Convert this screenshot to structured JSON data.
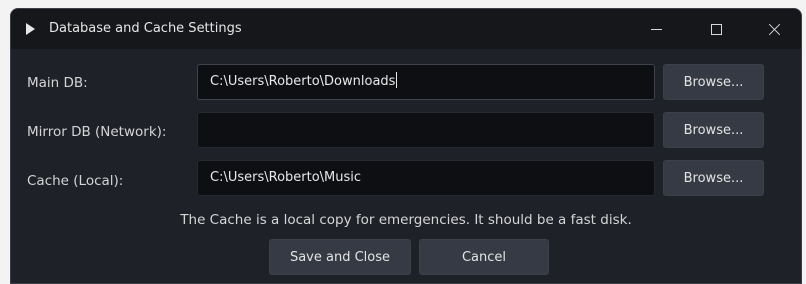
{
  "window": {
    "title": "Database and Cache Settings"
  },
  "rows": [
    {
      "label": "Main DB:",
      "value": "C:\\Users\\Roberto\\Downloads",
      "browse_label": "Browse..."
    },
    {
      "label": "Mirror DB (Network):",
      "value": "",
      "browse_label": "Browse..."
    },
    {
      "label": "Cache (Local):",
      "value": "C:\\Users\\Roberto\\Music",
      "browse_label": "Browse..."
    }
  ],
  "note": "The Cache is a local copy for emergencies. It should be a fast disk.",
  "buttons": {
    "save_label": "Save and Close",
    "cancel_label": "Cancel"
  },
  "colors": {
    "window_bg": "#1e2128",
    "titlebar_bg": "#15171b",
    "field_bg": "#0e0f12",
    "button_bg": "#363a44",
    "text": "#e3e3e3"
  }
}
